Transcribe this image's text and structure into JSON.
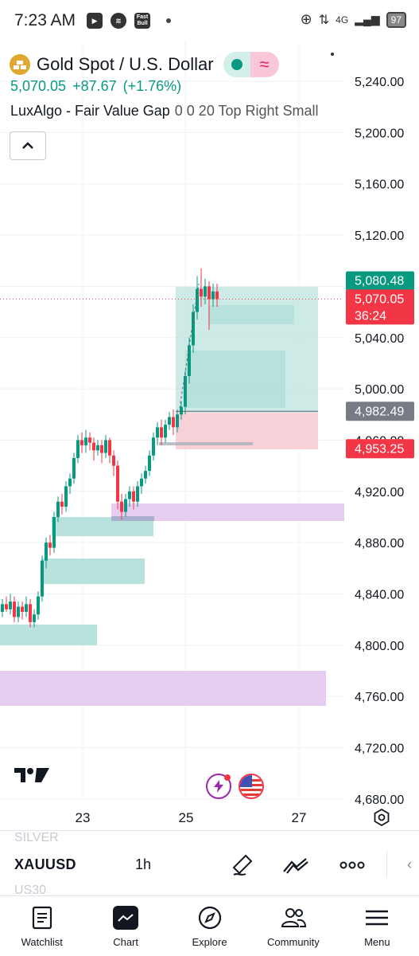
{
  "status_bar": {
    "time": "7:23 AM",
    "fastbull_label": "Fast Bull",
    "network": "4G",
    "battery": "97"
  },
  "header": {
    "title": "Gold Spot / U.S. Dollar",
    "last_price": "5,070.05",
    "change": "+87.67",
    "change_percent": "(+1.76%)",
    "indicator_name": "LuxAlgo - Fair Value Gap",
    "indicator_params": "0 0 20 Top Right Small"
  },
  "chart_data": {
    "type": "candlestick",
    "y_axis": {
      "range": [
        4680,
        5250
      ],
      "ticks": [
        "5,240.00",
        "5,200.00",
        "5,160.00",
        "5,120.00",
        "5,080.00",
        "5,040.00",
        "5,000.00",
        "4,960.00",
        "4,920.00",
        "4,880.00",
        "4,840.00",
        "4,800.00",
        "4,760.00",
        "4,720.00",
        "4,680.00"
      ]
    },
    "x_axis": {
      "ticks": [
        "23",
        "25",
        "27"
      ]
    },
    "price_labels": [
      {
        "value": "5,080.48",
        "color": "#089981"
      },
      {
        "value": "5,070.05",
        "sub": "36:24",
        "color": "#f23645"
      },
      {
        "value": "4,982.49",
        "color": "#787b86"
      },
      {
        "value": "4,953.25",
        "color": "#f23645"
      }
    ],
    "colors": {
      "up": "#089981",
      "down": "#f23645",
      "bull_fvg": "#b2dfd8",
      "bear_fvg": "#e4c9ef"
    }
  },
  "toolbar": {
    "ghost_top": "SILVER",
    "symbol": "XAUUSD",
    "interval": "1h",
    "ghost_bottom": "US30",
    "icons": [
      "brush-icon",
      "drawings-icon",
      "more-icon",
      "arrow-left-icon"
    ]
  },
  "nav": {
    "watchlist": "Watchlist",
    "chart": "Chart",
    "explore": "Explore",
    "community": "Community",
    "menu": "Menu"
  }
}
